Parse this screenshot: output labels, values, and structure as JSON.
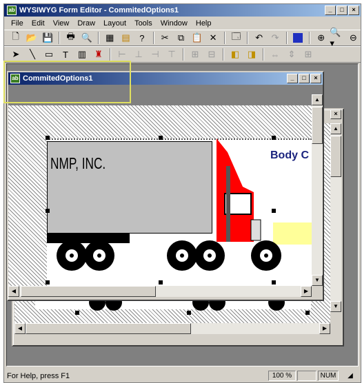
{
  "app": {
    "title": "WYSIWYG Form Editor - CommitedOptions1",
    "icon_label": "ab"
  },
  "menu": [
    "File",
    "Edit",
    "View",
    "Draw",
    "Layout",
    "Tools",
    "Window",
    "Help"
  ],
  "child_window": {
    "title": "CommitedOptions1",
    "icon_label": "ab"
  },
  "canvas": {
    "company_text": "NMP, INC.",
    "body_text": "Body C"
  },
  "status_bar": {
    "help_text": "For Help, press F1",
    "zoom": "100 %",
    "num": "NUM"
  },
  "colors": {
    "title_active": "#0a246a",
    "truck_cab": "#ff0000",
    "trailer": "#c0c0c0",
    "text_blue": "#1a237e",
    "yellow_field": "#ffff99"
  }
}
